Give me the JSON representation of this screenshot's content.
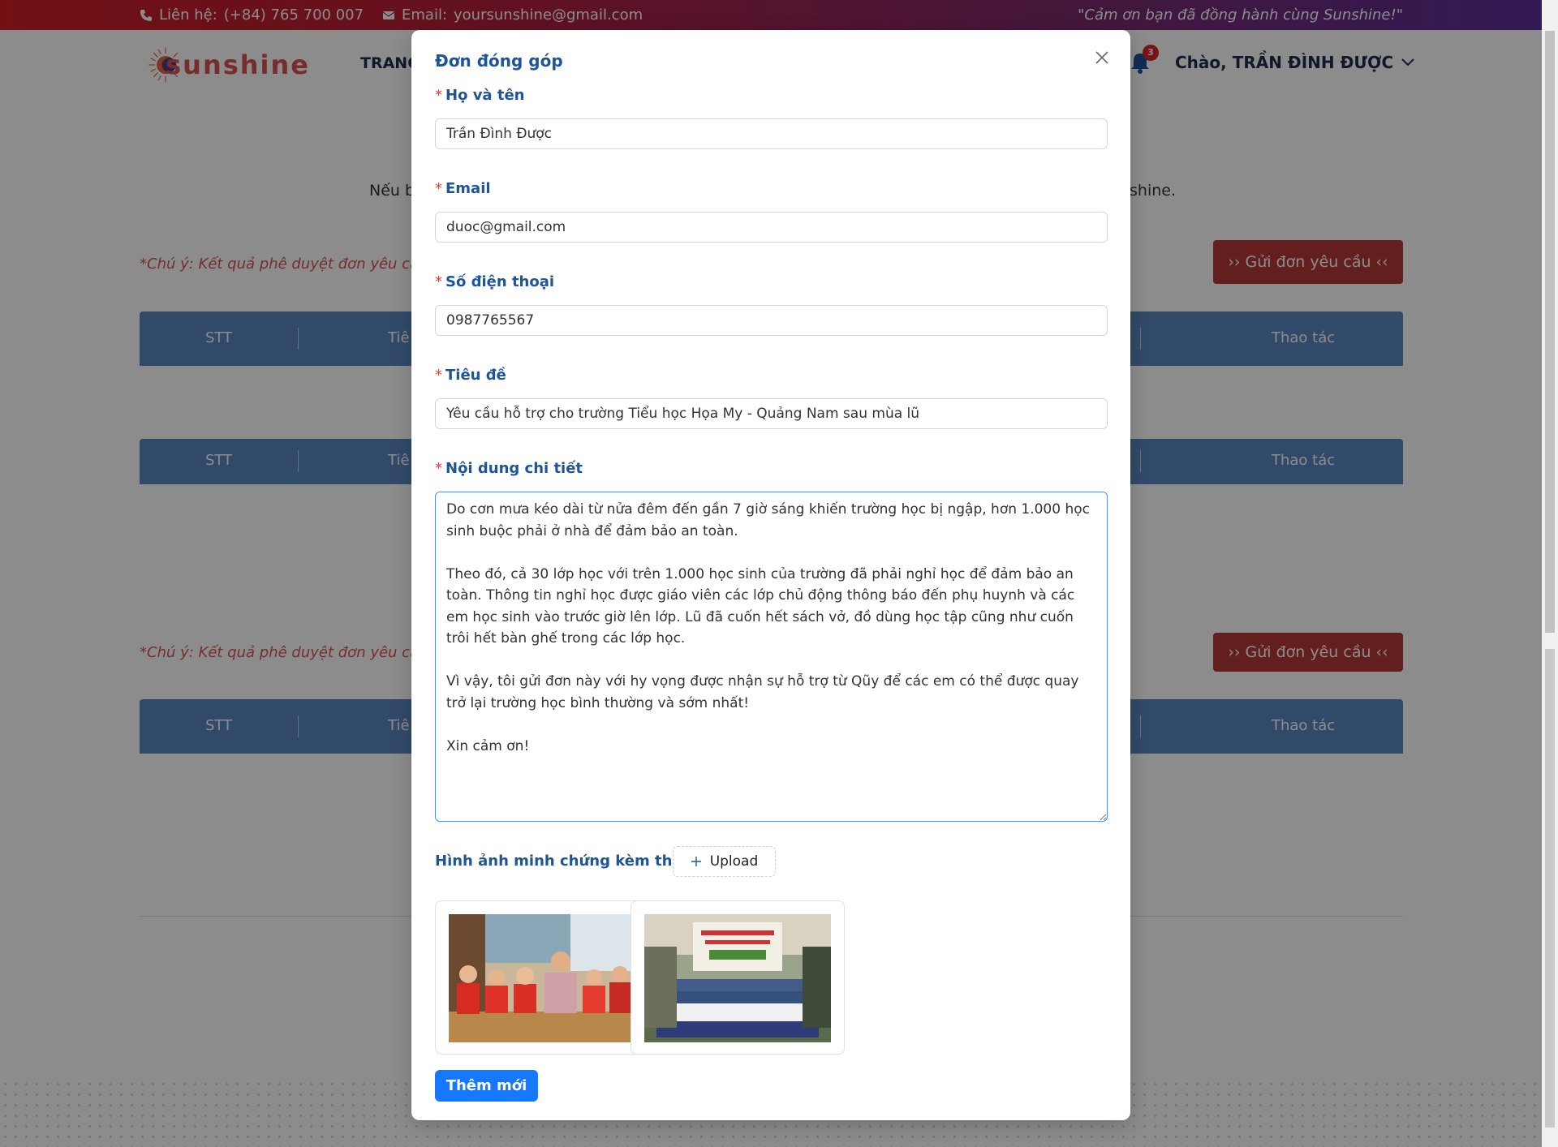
{
  "topbar": {
    "phone_label": "Liên hệ:",
    "phone": "(+84) 765 700 007",
    "email_label": "Email:",
    "email": "yoursunshine@gmail.com",
    "thanks": "\"Cảm ơn bạn đã đồng hành cùng Sunshine!\""
  },
  "nav": {
    "logo_text": "sunshine",
    "menu_first": "TRANG",
    "notification_count": "3",
    "greeting": "Chào, TRẦN ĐÌNH ĐƯỢC"
  },
  "page": {
    "intro_left": "Nếu b",
    "intro_right": "shine.",
    "note": "*Chú ý: Kết quả phê duyệt đơn yêu cầ",
    "send_button": "›› Gửi đơn yêu cầu ‹‹",
    "table": {
      "col_stt": "STT",
      "col_title": "Tiê",
      "col_action": "Thao tác"
    }
  },
  "modal": {
    "title": "Đơn đóng góp",
    "fields": {
      "name": {
        "label": "Họ và tên",
        "value": "Trần Đình Được"
      },
      "email": {
        "label": "Email",
        "value": "duoc@gmail.com"
      },
      "phone": {
        "label": "Số điện thoại",
        "value": "0987765567"
      },
      "subject": {
        "label": "Tiêu đề",
        "value": "Yêu cầu hỗ trợ cho trường Tiểu học Họa My - Quảng Nam sau mùa lũ"
      },
      "content": {
        "label": "Nội dung chi tiết",
        "value": "Do cơn mưa kéo dài từ nửa đêm đến gần 7 giờ sáng khiến trường học bị ngập, hơn 1.000 học sinh buộc phải ở nhà để đảm bảo an toàn.\n\nTheo đó, cả 30 lớp học với trên 1.000 học sinh của trường đã phải nghỉ học để đảm bảo an toàn. Thông tin nghỉ học được giáo viên các lớp chủ động thông báo đến phụ huynh và các em học sinh vào trước giờ lên lớp. Lũ đã cuốn hết sách vở, đồ dùng học tập cũng như cuốn trôi hết bàn ghế trong các lớp học.\n\nVì vậy, tôi gửi đơn này với hy vọng được nhận sự hỗ trợ từ Qũy để các em có thể được quay trở lại trường học bình thường và sớm nhất!\n\nXin cảm ơn!"
      }
    },
    "upload_label": "Hình ảnh minh chứng kèm theo:",
    "upload_button": "Upload",
    "images": [
      {
        "name": "classroom-photo"
      },
      {
        "name": "charity-event-photo"
      }
    ],
    "submit_button": "Thêm mới"
  },
  "colors": {
    "accent": "#1e5599",
    "primary_button": "#1677ff",
    "send_button": "#b53a36",
    "table_header": "#5b87c0",
    "required": "#e23b3b"
  }
}
